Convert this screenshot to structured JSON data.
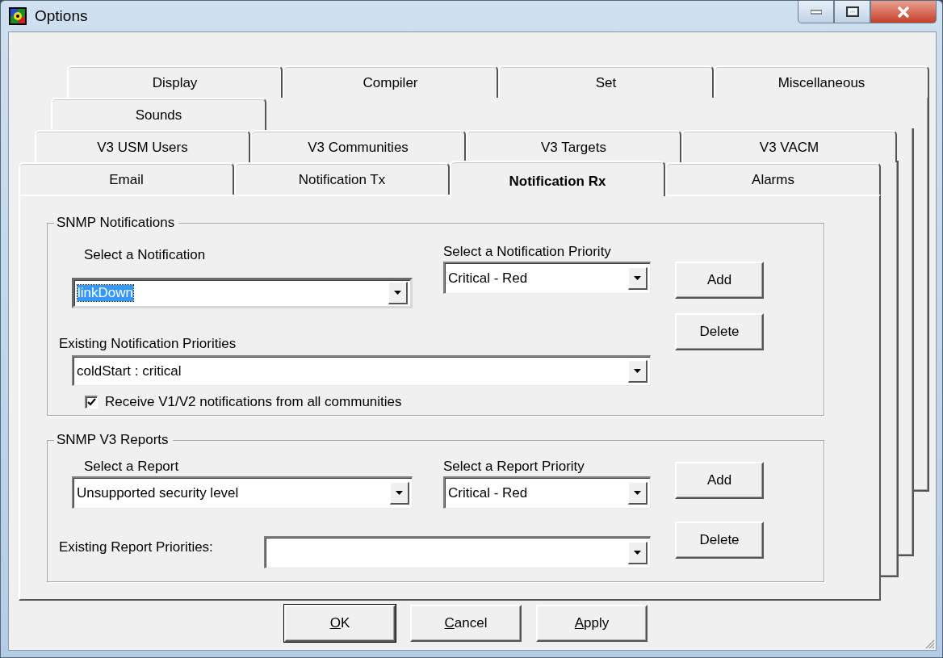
{
  "window": {
    "title": "Options"
  },
  "tab_rows": [
    [
      {
        "label": "Display",
        "selected": false
      },
      {
        "label": "Compiler",
        "selected": false
      },
      {
        "label": "Set",
        "selected": false
      },
      {
        "label": "Miscellaneous",
        "selected": false
      }
    ],
    [
      {
        "label": "Sounds",
        "selected": false
      }
    ],
    [
      {
        "label": "V3 USM Users",
        "selected": false
      },
      {
        "label": "V3 Communities",
        "selected": false
      },
      {
        "label": "V3 Targets",
        "selected": false
      },
      {
        "label": "V3 VACM",
        "selected": false
      }
    ],
    [
      {
        "label": "Email",
        "selected": false
      },
      {
        "label": "Notification Tx",
        "selected": false
      },
      {
        "label": "Notification Rx",
        "selected": true
      },
      {
        "label": "Alarms",
        "selected": false
      }
    ]
  ],
  "notifications": {
    "title": "SNMP Notifications",
    "select_label": "Select a Notification",
    "select_value": "linkDown",
    "select_value_highlighted": true,
    "priority_label": "Select a Notification Priority",
    "priority_value": "Critical - Red",
    "add_button": "Add",
    "existing_label": "Existing Notification Priorities",
    "existing_value": "coldStart : critical",
    "delete_button": "Delete",
    "checkbox": {
      "label": "Receive V1/V2 notifications from all communities",
      "checked": true
    }
  },
  "reports": {
    "title": "SNMP V3 Reports",
    "select_label": "Select a Report",
    "select_value": "Unsupported security level",
    "priority_label": "Select a Report Priority",
    "priority_value": "Critical - Red",
    "add_button": "Add",
    "existing_label": "Existing Report Priorities:",
    "delete_button": "Delete"
  },
  "buttons": [
    {
      "label": "OK",
      "default": true
    },
    {
      "label": "Cancel",
      "default": false
    },
    {
      "label": "Apply",
      "default": false
    }
  ]
}
